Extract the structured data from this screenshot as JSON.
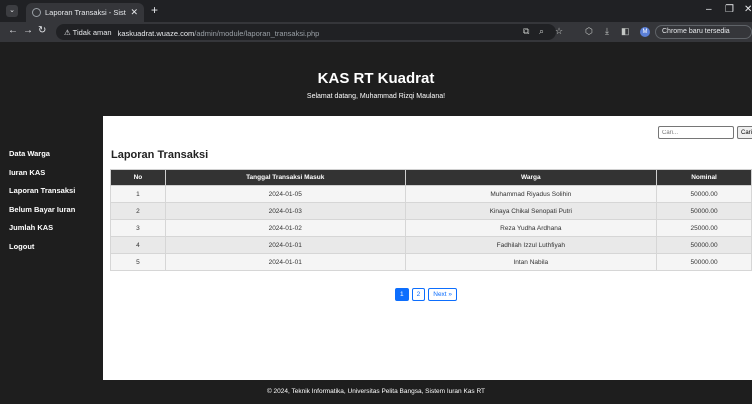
{
  "browser": {
    "tab_title": "Laporan Transaksi - Sistem Iura",
    "tab_close": "✕",
    "new_tab": "+",
    "not_secure_label": "Tidak aman",
    "url_host": "kaskuadrat.wuaze.com",
    "url_path": "/admin/module/laporan_transaksi.php",
    "profile_initial": "M",
    "update_label": "Chrome baru tersedia"
  },
  "header": {
    "title": "KAS RT Kuadrat",
    "welcome": "Selamat datang, Muhammad Rizqi Maulana!"
  },
  "sidebar": {
    "items": [
      {
        "label": "Data Warga"
      },
      {
        "label": "Iuran KAS"
      },
      {
        "label": "Laporan Transaksi"
      },
      {
        "label": "Belum Bayar Iuran"
      },
      {
        "label": "Jumlah KAS"
      },
      {
        "label": "Logout"
      }
    ]
  },
  "search": {
    "placeholder": "Cari...",
    "button_label": "Cari"
  },
  "content": {
    "title": "Laporan Transaksi"
  },
  "table": {
    "headers": [
      "No",
      "Tanggal Transaksi Masuk",
      "Warga",
      "Nominal"
    ],
    "rows": [
      [
        "1",
        "2024-01-05",
        "Muhammad Riyadus Solihin",
        "50000.00"
      ],
      [
        "2",
        "2024-01-03",
        "Kinaya Chikal Senopati Putri",
        "50000.00"
      ],
      [
        "3",
        "2024-01-02",
        "Reza Yudha Ardhana",
        "25000.00"
      ],
      [
        "4",
        "2024-01-01",
        "Fadhilah Izzul Luthfiyah",
        "50000.00"
      ],
      [
        "5",
        "2024-01-01",
        "Intan Nabila",
        "50000.00"
      ]
    ]
  },
  "pagination": {
    "pages": [
      "1",
      "2"
    ],
    "next_label": "Next »",
    "current": "1"
  },
  "footer": {
    "text": "© 2024, Teknik Informatika, Universitas Pelita Bangsa, Sistem Iuran Kas RT"
  },
  "colors": {
    "page_bg": "#1e1e1e",
    "table_header": "#333333",
    "accent": "#0d6efd"
  }
}
